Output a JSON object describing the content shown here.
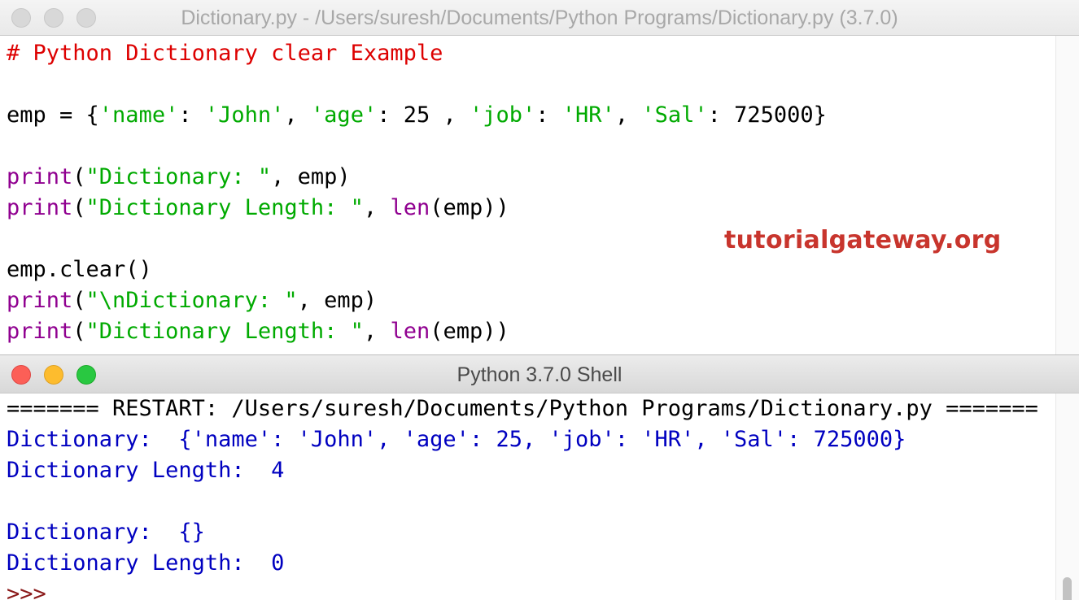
{
  "editor": {
    "title": "Dictionary.py - /Users/suresh/Documents/Python Programs/Dictionary.py (3.7.0)",
    "watermark": "tutorialgateway.org",
    "lines": [
      [
        {
          "t": "# Python Dictionary clear Example",
          "c": "comment"
        }
      ],
      [],
      [
        {
          "t": "emp = {",
          "c": "plain"
        },
        {
          "t": "'name'",
          "c": "string"
        },
        {
          "t": ": ",
          "c": "plain"
        },
        {
          "t": "'John'",
          "c": "string"
        },
        {
          "t": ", ",
          "c": "plain"
        },
        {
          "t": "'age'",
          "c": "string"
        },
        {
          "t": ": 25 , ",
          "c": "plain"
        },
        {
          "t": "'job'",
          "c": "string"
        },
        {
          "t": ": ",
          "c": "plain"
        },
        {
          "t": "'HR'",
          "c": "string"
        },
        {
          "t": ", ",
          "c": "plain"
        },
        {
          "t": "'Sal'",
          "c": "string"
        },
        {
          "t": ": 725000}",
          "c": "plain"
        }
      ],
      [],
      [
        {
          "t": "print",
          "c": "keyword"
        },
        {
          "t": "(",
          "c": "plain"
        },
        {
          "t": "\"Dictionary: \"",
          "c": "string"
        },
        {
          "t": ", emp)",
          "c": "plain"
        }
      ],
      [
        {
          "t": "print",
          "c": "keyword"
        },
        {
          "t": "(",
          "c": "plain"
        },
        {
          "t": "\"Dictionary Length: \"",
          "c": "string"
        },
        {
          "t": ", ",
          "c": "plain"
        },
        {
          "t": "len",
          "c": "keyword"
        },
        {
          "t": "(emp))",
          "c": "plain"
        }
      ],
      [],
      [
        {
          "t": "emp.clear()",
          "c": "plain"
        }
      ],
      [
        {
          "t": "print",
          "c": "keyword"
        },
        {
          "t": "(",
          "c": "plain"
        },
        {
          "t": "\"\\nDictionary: \"",
          "c": "string"
        },
        {
          "t": ", emp)",
          "c": "plain"
        }
      ],
      [
        {
          "t": "print",
          "c": "keyword"
        },
        {
          "t": "(",
          "c": "plain"
        },
        {
          "t": "\"Dictionary Length: \"",
          "c": "string"
        },
        {
          "t": ", ",
          "c": "plain"
        },
        {
          "t": "len",
          "c": "keyword"
        },
        {
          "t": "(emp))",
          "c": "plain"
        }
      ]
    ]
  },
  "shell": {
    "title": "Python 3.7.0 Shell",
    "lines": [
      [
        {
          "t": "======= RESTART: /Users/suresh/Documents/Python Programs/Dictionary.py =======",
          "c": "plain"
        }
      ],
      [
        {
          "t": "Dictionary:  {'name': 'John', 'age': 25, 'job': 'HR', 'Sal': 725000}",
          "c": "output"
        }
      ],
      [
        {
          "t": "Dictionary Length:  4",
          "c": "output"
        }
      ],
      [],
      [
        {
          "t": "Dictionary:  {}",
          "c": "output"
        }
      ],
      [
        {
          "t": "Dictionary Length:  0",
          "c": "output"
        }
      ],
      [
        {
          "t": ">>> ",
          "c": "prompt"
        }
      ]
    ]
  },
  "colors": {
    "comment": "#dd0000",
    "keyword": "#900090",
    "string": "#00aa00",
    "output": "#0000c0",
    "watermark": "#c8352d"
  }
}
